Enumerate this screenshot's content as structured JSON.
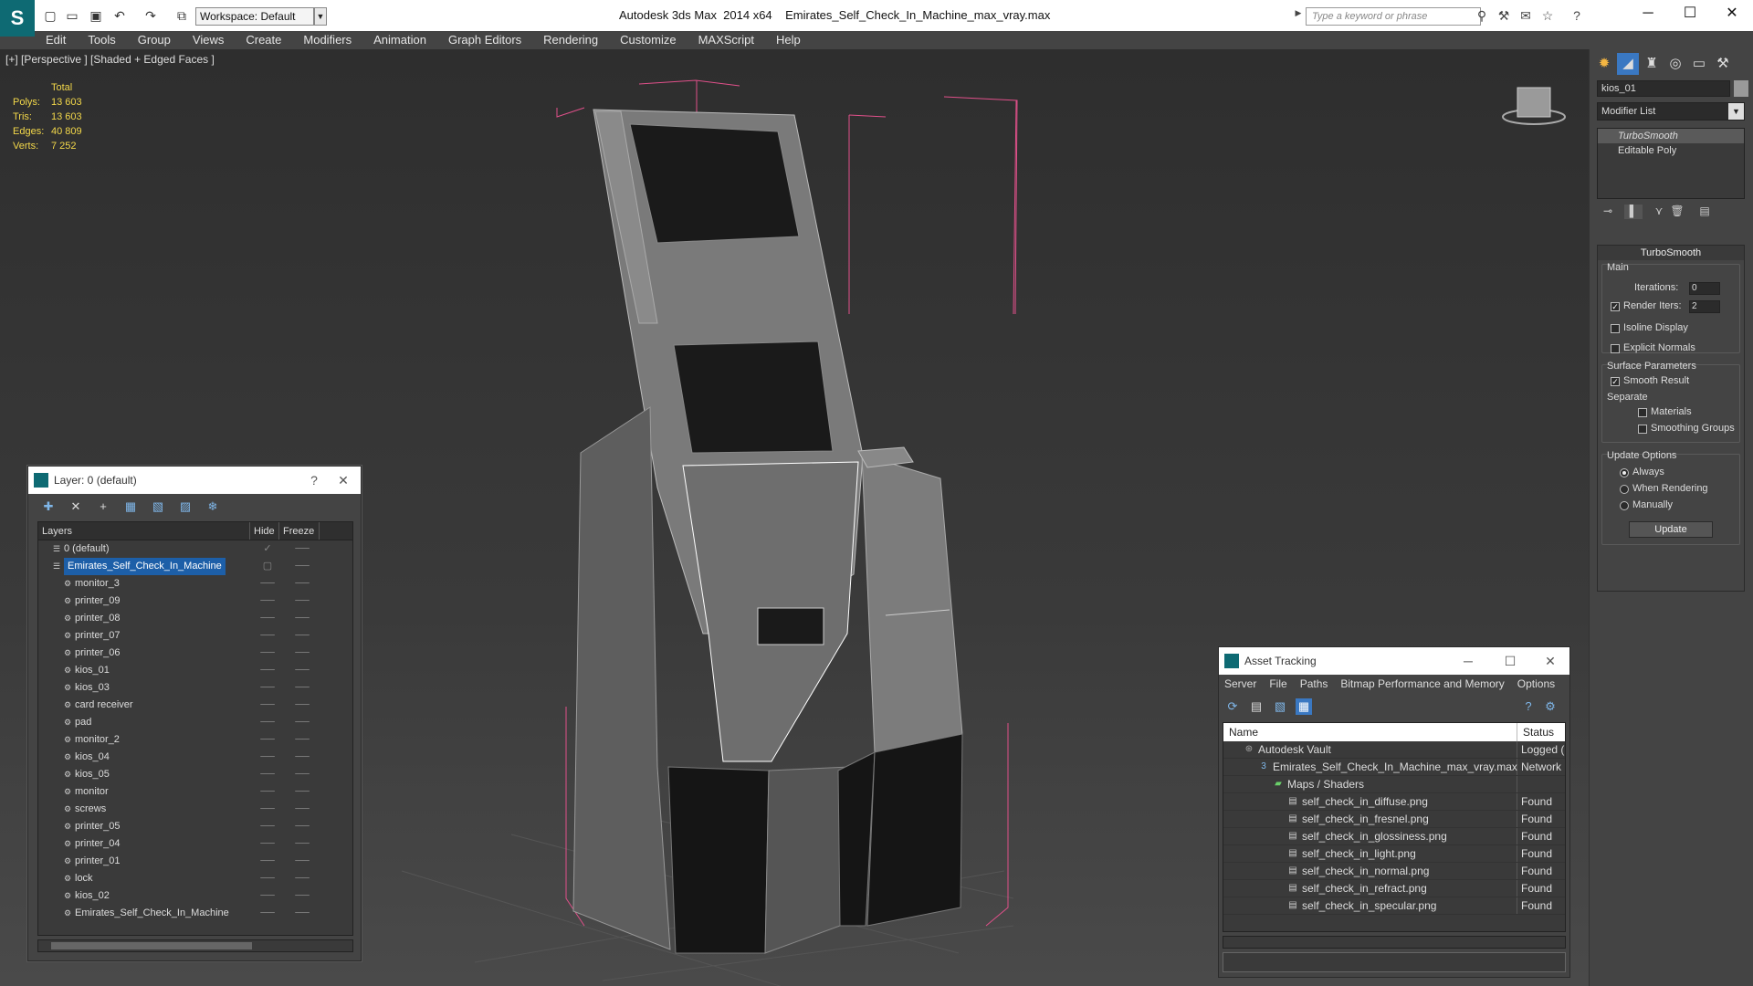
{
  "titlebar": {
    "workspace": "Workspace: Default",
    "app_name": "Autodesk 3ds Max  2014 x64",
    "file_name": "Emirates_Self_Check_In_Machine_max_vray.max",
    "search_placeholder": "Type a keyword or phrase"
  },
  "menu": [
    "Edit",
    "Tools",
    "Group",
    "Views",
    "Create",
    "Modifiers",
    "Animation",
    "Graph Editors",
    "Rendering",
    "Customize",
    "MAXScript",
    "Help"
  ],
  "viewport": {
    "label": "[+] [Perspective ] [Shaded + Edged Faces ]",
    "stats_header": "Total",
    "stats": [
      {
        "k": "Polys:",
        "v": "13 603"
      },
      {
        "k": "Tris:",
        "v": "13 603"
      },
      {
        "k": "Edges:",
        "v": "40 809"
      },
      {
        "k": "Verts:",
        "v": "7 252"
      }
    ]
  },
  "command_panel": {
    "object_name": "kios_01",
    "modifier_list": "Modifier List",
    "stack": [
      "TurboSmooth",
      "Editable Poly"
    ],
    "rollout_title": "TurboSmooth",
    "main_label": "Main",
    "iterations_label": "Iterations:",
    "iterations_value": "0",
    "render_iters_label": "Render Iters:",
    "render_iters_value": "2",
    "isoline": "Isoline Display",
    "explicit_normals": "Explicit Normals",
    "surface_params": "Surface Parameters",
    "smooth_result": "Smooth Result",
    "separate": "Separate",
    "materials": "Materials",
    "smoothing_groups": "Smoothing Groups",
    "update_options": "Update Options",
    "always": "Always",
    "when_rendering": "When Rendering",
    "manually": "Manually",
    "update_btn": "Update"
  },
  "layer_window": {
    "title": "Layer: 0 (default)",
    "col_layers": "Layers",
    "col_hide": "Hide",
    "col_freeze": "Freeze",
    "rows": [
      {
        "name": "0 (default)",
        "level": 0
      },
      {
        "name": "Emirates_Self_Check_In_Machine",
        "level": 0,
        "selected": true
      },
      {
        "name": "monitor_3",
        "level": 1
      },
      {
        "name": "printer_09",
        "level": 1
      },
      {
        "name": "printer_08",
        "level": 1
      },
      {
        "name": "printer_07",
        "level": 1
      },
      {
        "name": "printer_06",
        "level": 1
      },
      {
        "name": "kios_01",
        "level": 1
      },
      {
        "name": "kios_03",
        "level": 1
      },
      {
        "name": "card receiver",
        "level": 1
      },
      {
        "name": "pad",
        "level": 1
      },
      {
        "name": "monitor_2",
        "level": 1
      },
      {
        "name": "kios_04",
        "level": 1
      },
      {
        "name": "kios_05",
        "level": 1
      },
      {
        "name": "monitor",
        "level": 1
      },
      {
        "name": "screws",
        "level": 1
      },
      {
        "name": "printer_05",
        "level": 1
      },
      {
        "name": "printer_04",
        "level": 1
      },
      {
        "name": "printer_01",
        "level": 1
      },
      {
        "name": "lock",
        "level": 1
      },
      {
        "name": "kios_02",
        "level": 1
      },
      {
        "name": "Emirates_Self_Check_In_Machine",
        "level": 1
      }
    ]
  },
  "asset_window": {
    "title": "Asset Tracking",
    "menu": [
      "Server",
      "File",
      "Paths",
      "Bitmap Performance and Memory",
      "Options"
    ],
    "col_name": "Name",
    "col_status": "Status",
    "rows": [
      {
        "name": "Autodesk Vault",
        "status": "Logged (",
        "level": 0,
        "icon": "vault"
      },
      {
        "name": "Emirates_Self_Check_In_Machine_max_vray.max",
        "status": "Network",
        "level": 1,
        "icon": "max"
      },
      {
        "name": "Maps / Shaders",
        "status": "",
        "level": 2,
        "icon": "maps"
      },
      {
        "name": "self_check_in_diffuse.png",
        "status": "Found",
        "level": 3,
        "icon": "file"
      },
      {
        "name": "self_check_in_fresnel.png",
        "status": "Found",
        "level": 3,
        "icon": "file"
      },
      {
        "name": "self_check_in_glossiness.png",
        "status": "Found",
        "level": 3,
        "icon": "file"
      },
      {
        "name": "self_check_in_light.png",
        "status": "Found",
        "level": 3,
        "icon": "file"
      },
      {
        "name": "self_check_in_normal.png",
        "status": "Found",
        "level": 3,
        "icon": "file"
      },
      {
        "name": "self_check_in_refract.png",
        "status": "Found",
        "level": 3,
        "icon": "file"
      },
      {
        "name": "self_check_in_specular.png",
        "status": "Found",
        "level": 3,
        "icon": "file"
      }
    ]
  },
  "colors": {
    "accent": "#1d5fa8",
    "stats": "#f3d84a",
    "bbox": "#e0508a",
    "logo": "#0e6a73"
  }
}
